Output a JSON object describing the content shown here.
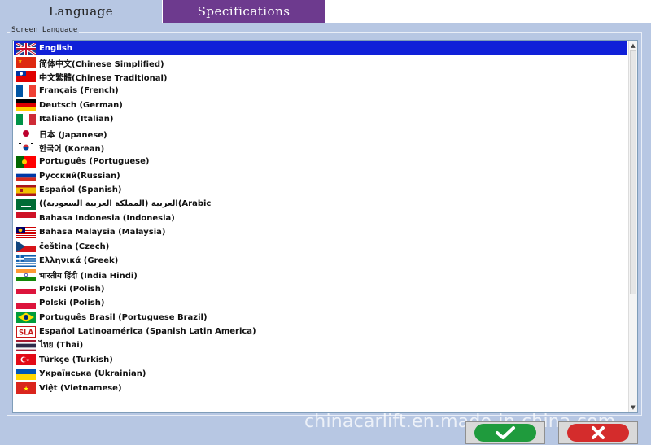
{
  "tabs": [
    {
      "label": "Language",
      "active": true
    },
    {
      "label": "Specifications",
      "active": false
    }
  ],
  "group_label": "Screen Language",
  "selected_index": 0,
  "languages": [
    {
      "label": "English",
      "flag": "uk-flag"
    },
    {
      "label": "简体中文(Chinese Simplified)",
      "flag": "china-flag"
    },
    {
      "label": "中文繁體(Chinese Traditional)",
      "flag": "taiwan-flag"
    },
    {
      "label": "Français (French)",
      "flag": "france-flag"
    },
    {
      "label": "Deutsch (German)",
      "flag": "germany-flag"
    },
    {
      "label": "Italiano (Italian)",
      "flag": "italy-flag"
    },
    {
      "label": "日本 (Japanese)",
      "flag": "japan-flag"
    },
    {
      "label": "한국어 (Korean)",
      "flag": "korea-flag"
    },
    {
      "label": "Português (Portuguese)",
      "flag": "portugal-flag"
    },
    {
      "label": "Русский(Russian)",
      "flag": "russia-flag"
    },
    {
      "label": "Español (Spanish)",
      "flag": "spain-flag"
    },
    {
      "label": "(العربية (المملكة العربية السعودية)(Arabic",
      "flag": "saudi-flag"
    },
    {
      "label": "Bahasa Indonesia (Indonesia)",
      "flag": "indonesia-flag"
    },
    {
      "label": "Bahasa Malaysia (Malaysia)",
      "flag": "malaysia-flag"
    },
    {
      "label": "čeština (Czech)",
      "flag": "czech-flag"
    },
    {
      "label": "Ελληνικά (Greek)",
      "flag": "greece-flag"
    },
    {
      "label": "भारतीय हिंदी (India Hindi)",
      "flag": "india-flag"
    },
    {
      "label": "Polski (Polish)",
      "flag": "poland-flag"
    },
    {
      "label": "Polski (Polish)",
      "flag": "poland-flag"
    },
    {
      "label": "Português Brasil (Portuguese Brazil)",
      "flag": "brazil-flag"
    },
    {
      "label": "Español Latinoamérica (Spanish Latin America)",
      "flag": "sla-flag",
      "flag_text": "SLA"
    },
    {
      "label": "ไทย (Thai)",
      "flag": "thailand-flag"
    },
    {
      "label": "Türkçe (Turkish)",
      "flag": "turkey-flag"
    },
    {
      "label": "Українська (Ukrainian)",
      "flag": "ukraine-flag"
    },
    {
      "label": "Việt (Vietnamese)",
      "flag": "vietnam-flag"
    }
  ],
  "watermark": "chinacarlift.en.made-in-china.com",
  "buttons": {
    "ok": {
      "icon": "checkmark-icon",
      "color": "#1f9b3d"
    },
    "cancel": {
      "icon": "x-icon",
      "color": "#d42c2c"
    }
  },
  "colors": {
    "background": "#b7c7e3",
    "inactive_tab": "#6d3a8e",
    "selection": "#1020d8"
  }
}
